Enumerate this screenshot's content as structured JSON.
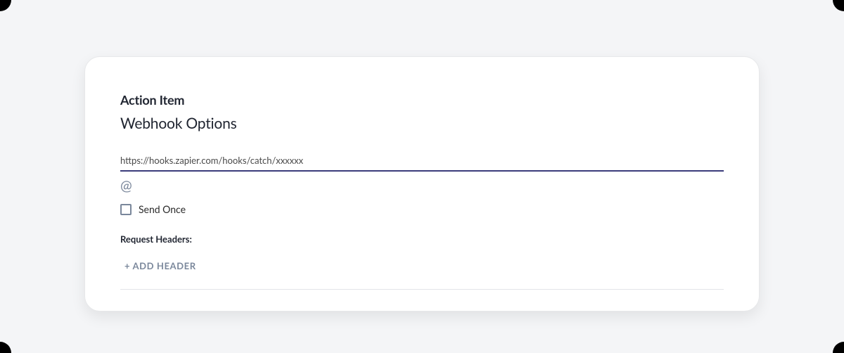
{
  "section": {
    "label": "Action Item",
    "title": "Webhook Options"
  },
  "url_input": {
    "value": "https://hooks.zapier.com/hooks/catch/xxxxxx"
  },
  "at_symbol": "@",
  "send_once": {
    "label": "Send Once",
    "checked": false
  },
  "request_headers": {
    "label": "Request Headers:",
    "add_button": "+ ADD HEADER"
  }
}
